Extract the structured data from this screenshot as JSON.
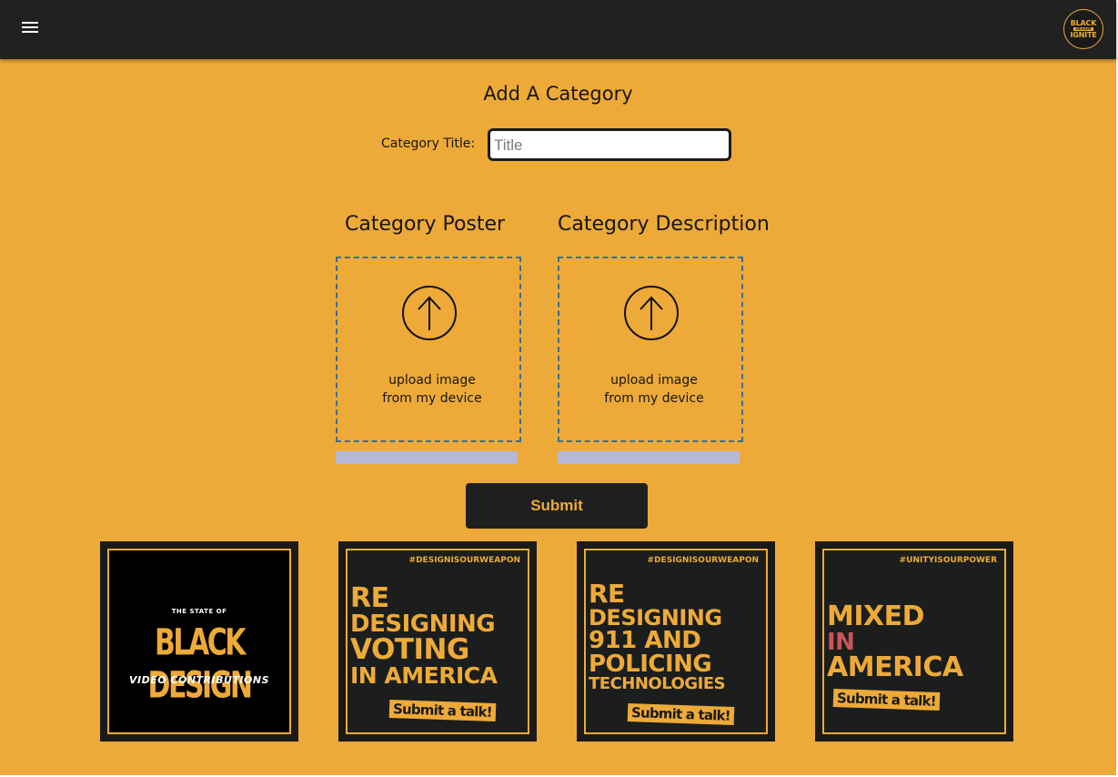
{
  "header": {
    "menu_icon": "hamburger-menu-icon",
    "logo": {
      "line1": "BLACK",
      "line2": "DESIGN",
      "line3": "IGNITE"
    }
  },
  "form": {
    "title": "Add A Category",
    "category_title_label": "Category Title:",
    "category_title_placeholder": "Title",
    "category_title_value": "",
    "poster": {
      "heading": "Category Poster",
      "upload_icon": "upload-arrow-icon",
      "upload_line1": "upload image",
      "upload_line2": "from my device",
      "progress": 0
    },
    "description": {
      "heading": "Category Description",
      "upload_icon": "upload-arrow-icon",
      "upload_line1": "upload image",
      "upload_line2": "from my device",
      "progress": 0
    },
    "submit_label": "Submit"
  },
  "posters": [
    {
      "top": "THE STATE OF",
      "main": "BLACK DESIGN",
      "sub": "VIDEO CONTRIBUTIONS"
    },
    {
      "hashtag": "#DESIGNISOURWEAPON",
      "lines": [
        "RE",
        "DESIGNING",
        "VOTING",
        "IN AMERICA"
      ],
      "cta": "Submit a talk!"
    },
    {
      "hashtag": "#DESIGNISOURWEAPON",
      "lines": [
        "RE",
        "DESIGNING",
        "911 AND",
        "POLICING",
        "TECHNOLOGIES"
      ],
      "cta": "Submit a talk!"
    },
    {
      "hashtag": "#UNITYISOURPOWER",
      "lines": [
        "MIXED",
        "IN",
        "AMERICA"
      ],
      "cta": "Submit a talk!"
    }
  ],
  "colors": {
    "background": "#eeaa38",
    "topbar": "#212121",
    "accent": "#eeaa38",
    "progress_track": "#b8b7d8",
    "upload_border": "#3f6b8f",
    "poster_accent_red": "#c9545a"
  }
}
